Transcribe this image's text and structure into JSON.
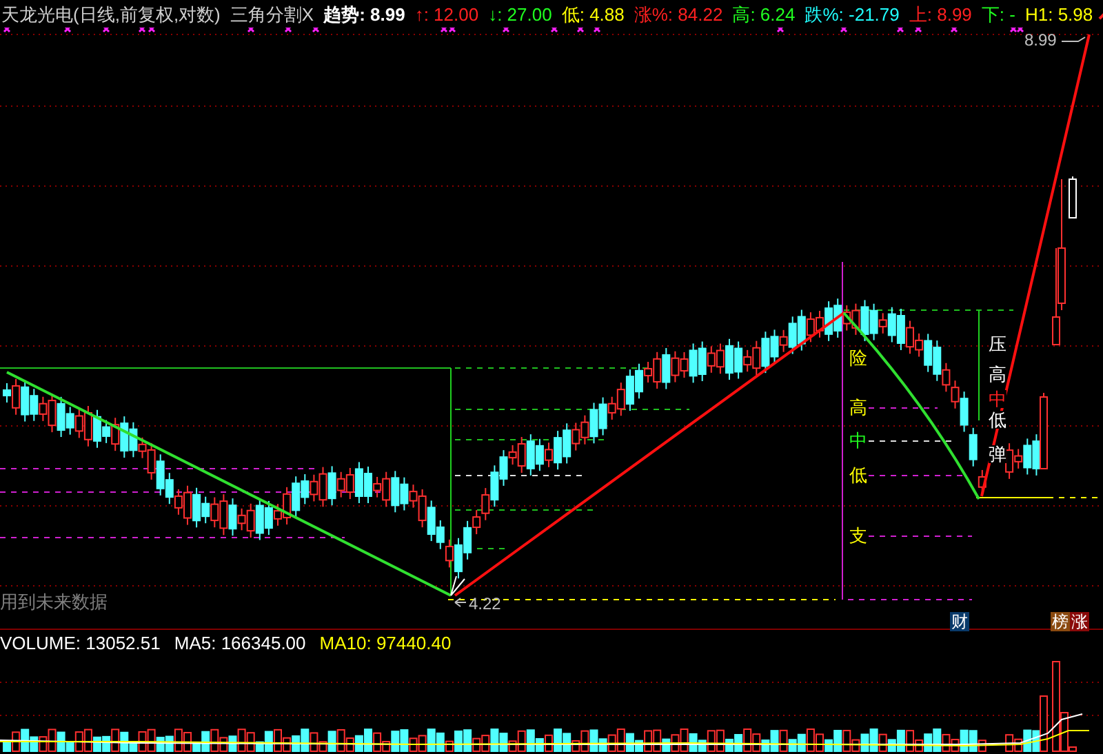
{
  "header": {
    "title": "天龙光电(日线,前复权,对数)",
    "indicator": "三角分割X",
    "fields": [
      {
        "label": "趋势:",
        "value": "8.99",
        "color": "#ffffff"
      },
      {
        "label": "↑:",
        "value": "12.00",
        "color": "#ff2020"
      },
      {
        "label": "↓:",
        "value": "27.00",
        "color": "#20ff20"
      },
      {
        "label": "低:",
        "value": "4.88",
        "color": "#ffff00"
      },
      {
        "label": "涨%:",
        "value": "84.22",
        "color": "#ff2020"
      },
      {
        "label": "高:",
        "value": "6.24",
        "color": "#20ff20"
      },
      {
        "label": "跌%:",
        "value": "-21.79",
        "color": "#20ffff"
      },
      {
        "label": "上:",
        "value": "8.99",
        "color": "#ff2020"
      },
      {
        "label": "下:",
        "value": "-",
        "color": "#20ff20"
      },
      {
        "label": "H1:",
        "value": "5.98",
        "color": "#ffff00"
      }
    ]
  },
  "chart": {
    "labels": [
      {
        "kind": "price",
        "text": "8.99",
        "color": "#c0c0c0"
      },
      {
        "kind": "price",
        "text": "4.22",
        "color": "#c0c0c0"
      },
      {
        "kind": "level",
        "text": "险",
        "color": "#ffff00"
      },
      {
        "kind": "level",
        "text": "高",
        "color": "#ffff00"
      },
      {
        "kind": "level",
        "text": "中",
        "color": "#20ff20"
      },
      {
        "kind": "level",
        "text": "低",
        "color": "#ffff00"
      },
      {
        "kind": "level",
        "text": "支",
        "color": "#ffff00"
      },
      {
        "kind": "level",
        "text": "压",
        "color": "#ffffff"
      },
      {
        "kind": "level",
        "text": "高",
        "color": "#ffffff"
      },
      {
        "kind": "level",
        "text": "中",
        "color": "#ff2020"
      },
      {
        "kind": "level",
        "text": "低",
        "color": "#ffffff"
      },
      {
        "kind": "level",
        "text": "弹",
        "color": "#ffffff"
      },
      {
        "kind": "note",
        "text": "用到未来数据",
        "color": "#808080"
      }
    ],
    "badges": [
      {
        "text": "财",
        "color": "#0a3a6a"
      },
      {
        "text": "榜",
        "color": "#8a4a10"
      },
      {
        "text": "涨",
        "color": "#8a0a0a"
      }
    ]
  },
  "volume": {
    "fields": [
      {
        "label": "VOLUME:",
        "value": "13052.51",
        "color": "#ffffff"
      },
      {
        "label": "MA5:",
        "value": "166345.00",
        "color": "#ffffff"
      },
      {
        "label": "MA10:",
        "value": "97440.40",
        "color": "#ffff00"
      }
    ]
  }
}
